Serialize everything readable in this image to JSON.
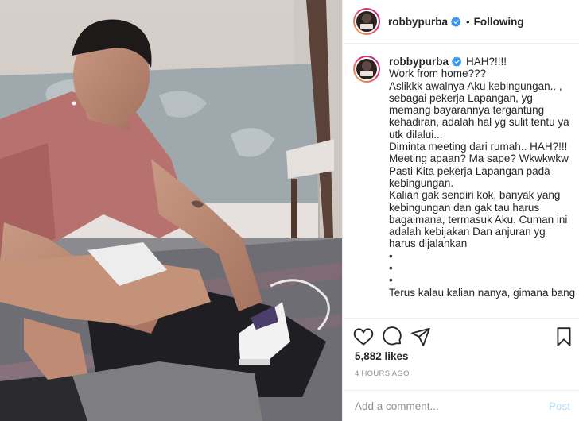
{
  "colors": {
    "accent": "#0095f6",
    "post_disabled": "#b2dffc",
    "muted": "#8e8e8e",
    "verified": "#3897f0"
  },
  "header": {
    "username": "robbypurba",
    "dot": "•",
    "follow_status": "Following"
  },
  "caption": {
    "username": "robbypurba",
    "first_line": "HAH?!!!!",
    "lines": [
      "Work from home???",
      "Aslikkk awalnya Aku kebingungan.. ,",
      "sebagai pekerja Lapangan, yg",
      "memang bayarannya tergantung",
      "kehadiran, adalah hal yg sulit tentu ya",
      "utk dilalui...",
      "Diminta meeting dari rumah.. HAH?!!!",
      "Meeting apaan? Ma sape? Wkwkwkw",
      "Pasti Kita pekerja Lapangan pada",
      "kebingungan.",
      "Kalian gak sendiri kok, banyak yang",
      "kebingungan dan gak tau harus",
      "bagaimana, termasuk Aku. Cuman ini",
      "adalah kebijakan Dan anjuran yg",
      "harus dijalankan",
      "•",
      "•",
      "•",
      "Terus kalau kalian nanya, gimana bang"
    ]
  },
  "actions": {
    "icons": [
      "heart-icon",
      "comment-icon",
      "share-icon",
      "bookmark-icon"
    ]
  },
  "likes": "5,882 likes",
  "timestamp": "4 HOURS AGO",
  "comment_box": {
    "placeholder": "Add a comment...",
    "post_label": "Post"
  }
}
